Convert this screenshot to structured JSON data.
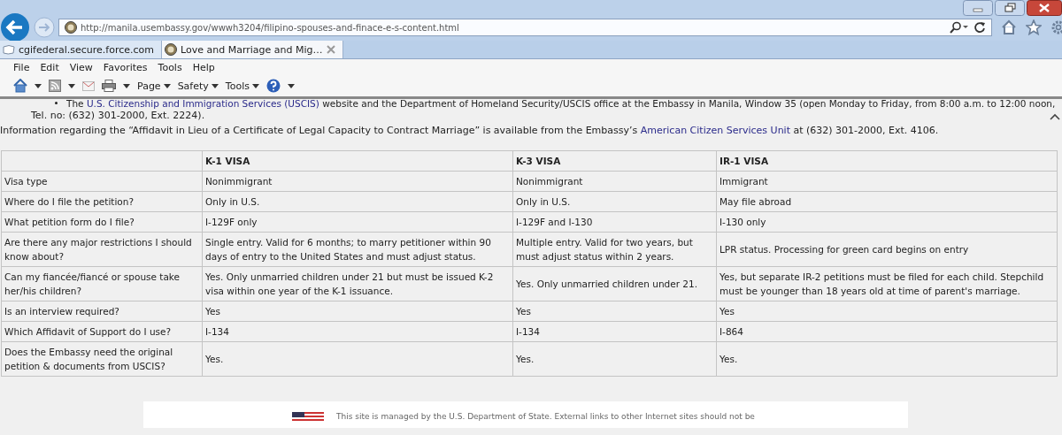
{
  "browser": {
    "url": "http://manila.usembassy.gov/wwwh3204/filipino-spouses-and-finace-e-s-content.html",
    "tabs": [
      {
        "label": "cgifederal.secure.force.com",
        "selected": false
      },
      {
        "label": "Love and Marriage and Mig…",
        "selected": true
      }
    ],
    "menu": [
      "File",
      "Edit",
      "View",
      "Favorites",
      "Tools",
      "Help"
    ],
    "command_bar": [
      "Page",
      "Safety",
      "Tools"
    ]
  },
  "content": {
    "bullet": {
      "link": "U.S. Citizenship and Immigration Services (USCIS)",
      "before": "The ",
      "after": " website and the Department of Homeland Security/USCIS office at the Embassy in Manila, Window 35 (open Monday to Friday, from 8:00 a.m. to 12:00 noon,",
      "continuation": "Tel. no: (632) 301-2000, Ext. 2224)."
    },
    "info": {
      "before": "Information regarding the “Affidavit in Lieu of a Certificate of Legal Capacity to Contract Marriage” is available from the Embassy’s ",
      "link": "American Citizen Services Unit",
      "after": " at (632) 301-2000, Ext. 4106."
    },
    "table": {
      "columns": [
        "",
        "K-1 VISA",
        "K-3 VISA",
        "IR-1 VISA"
      ],
      "rows": [
        [
          "Visa type",
          "Nonimmigrant",
          "Nonimmigrant",
          "Immigrant"
        ],
        [
          "Where do I file the petition?",
          "Only in U.S.",
          "Only in U.S.",
          "May file abroad"
        ],
        [
          "What petition form do I file?",
          "I-129F only",
          "I-129F and I-130",
          "I-130 only"
        ],
        [
          "Are there any major restrictions I should know about?",
          "Single entry. Valid for 6 months; to marry petitioner within 90 days of entry to the United States and must adjust status.",
          "Multiple entry. Valid for two years, but must adjust status within 2 years.",
          "LPR status. Processing for green card begins on entry"
        ],
        [
          "Can my fiancée/fiancé or spouse take her/his children?",
          "Yes. Only unmarried children under 21 but must be issued K-2 visa within one year of the K-1 issuance.",
          "Yes. Only unmarried children under 21.",
          "Yes, but separate IR-2 petitions must be filed for each child. Stepchild must be younger than 18 years old at time of parent's marriage."
        ],
        [
          "Is an interview required?",
          "Yes",
          "Yes",
          "Yes"
        ],
        [
          "Which Affidavit of Support do I use?",
          "I-134",
          "I-134",
          "I-864"
        ],
        [
          "Does the Embassy need the original petition & documents from USCIS?",
          "Yes.",
          "Yes.",
          "Yes."
        ]
      ]
    },
    "footer": "This site is managed by the U.S. Department of State. External links to other Internet sites should not be"
  }
}
